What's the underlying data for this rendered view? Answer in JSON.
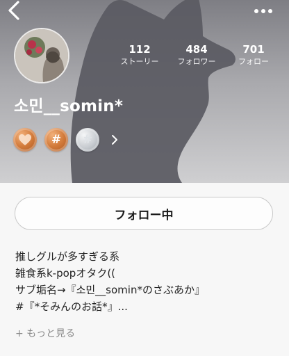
{
  "profile": {
    "username": "소민__somin*",
    "stats": [
      {
        "count": "112",
        "label": "ストーリー"
      },
      {
        "count": "484",
        "label": "フォロワー"
      },
      {
        "count": "701",
        "label": "フォロー"
      }
    ],
    "badges": [
      {
        "icon": "heart-badge-icon",
        "color": "#d27a3a"
      },
      {
        "icon": "hashtag-badge-icon",
        "color": "#d27a3a"
      },
      {
        "icon": "hashtag-silver-badge-icon",
        "color": "#c8ccd1"
      }
    ]
  },
  "actions": {
    "follow_label": "フォロー中"
  },
  "bio": {
    "lines": [
      "推しグルが多すぎる系",
      "雑食系k-popオタク((",
      "サブ垢名→『소민__somin*のさぶあか』",
      "#『*そみんのお話*』..."
    ],
    "more_label": "+ もっと見る"
  },
  "colors": {
    "header_bg": "#a9a9ad",
    "silhouette": "#5a5a62",
    "badge_bronze": "#d27a3a",
    "badge_silver": "#c8ccd1"
  },
  "icons": {
    "back": "chevron-left-icon",
    "more": "more-dots-icon"
  }
}
